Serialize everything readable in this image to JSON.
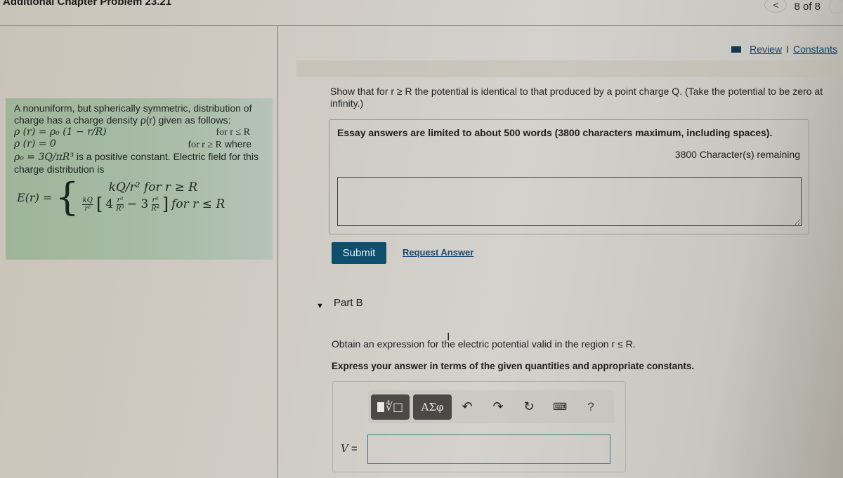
{
  "header": {
    "title": "Additional Chapter Problem 23.21",
    "pager": {
      "current": 8,
      "total": 8,
      "label": "8 of 8"
    },
    "prev_icon": "chevron-left-icon",
    "next_icon": "chevron-right-icon"
  },
  "links": {
    "book_icon": "book-icon",
    "review": "Review",
    "separator": "I",
    "constants": "Constants"
  },
  "problem_info": {
    "intro": "A nonuniform, but spherically symmetric, distribution of charge has a charge density ρ(r) given as follows:",
    "rho_inside_expr": "ρ (r) = ρ₀ (1 − r/R)",
    "rho_inside_cond": "for r ≤ R",
    "rho_outside_expr": "ρ (r) = 0",
    "rho_outside_cond": "for r ≥ R",
    "rho_outside_suffix": "where",
    "rho0_expr": "ρ₀ = 3Q/πR³",
    "rho0_text": "is a positive constant. Electric field for this charge distribution is",
    "efield_lhs": "E(r) =",
    "efield_case1": "kQ/r² for r ≥ R",
    "efield_case2_prefix_num": "kQ",
    "efield_case2_prefix_den": "r²",
    "efield_case2_bracket_open": "[",
    "efield_case2_coef1": "4",
    "efield_case2_frac1_num": "r³",
    "efield_case2_frac1_den": "R³",
    "efield_case2_minus": "− 3",
    "efield_case2_frac2_num": "r⁴",
    "efield_case2_frac2_den": "R⁴",
    "efield_case2_bracket_close": "]",
    "efield_case2_cond": "for r ≤ R"
  },
  "part_a": {
    "question": "Show that for r ≥ R the potential is identical to that produced by a point charge Q. (Take the potential to be zero at infinity.)",
    "essay_limit": "Essay answers are limited to about 500 words (3800 characters maximum, including spaces).",
    "chars_remaining": "3800 Character(s) remaining",
    "answer_value": "",
    "submit_label": "Submit",
    "request_answer_label": "Request Answer"
  },
  "part_b": {
    "toggle_icon": "▼",
    "label": "Part B",
    "question": "Obtain an expression for the electric potential valid in the region r ≤ R.",
    "instruction": "Express your answer in terms of the given quantities and appropriate constants.",
    "toolbar": {
      "templates_label": "∜□",
      "greek_label": "ΑΣφ",
      "undo_icon": "↶",
      "redo_icon": "↷",
      "reset_icon": "↻",
      "keyboard_icon": "⌨",
      "help_label": "?"
    },
    "answer_label": "V",
    "answer_equals": "=",
    "answer_value": ""
  }
}
